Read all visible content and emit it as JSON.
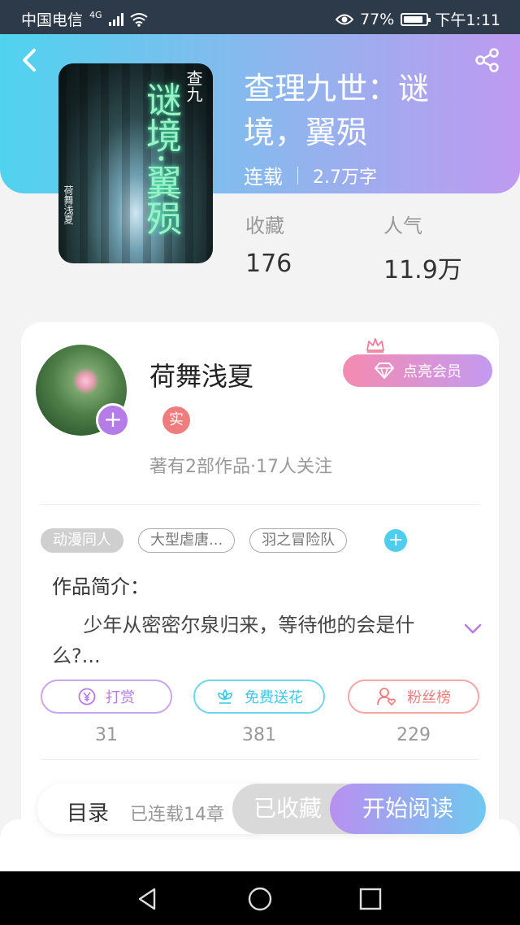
{
  "status_bar": {
    "carrier": "中国电信",
    "network": "4G",
    "battery": "77%",
    "time": "下午1:11",
    "icons": [
      "signal-icon",
      "wifi-icon",
      "eye-icon",
      "battery-icon"
    ]
  },
  "book": {
    "title": "查理九世：谜境，翼殒",
    "status": "连载",
    "word_count": "2.7万字",
    "cover_title": "谜境·翼殒",
    "cover_series": "查九",
    "cover_author": "荷舞浅夏"
  },
  "stats": {
    "favorites_label": "收藏",
    "favorites_value": "176",
    "popularity_label": "人气",
    "popularity_value": "11.9万"
  },
  "author": {
    "name": "荷舞浅夏",
    "badge": "实",
    "info": "著有2部作品·17人关注",
    "vip_button": "点亮会员"
  },
  "tags": [
    "动漫同人",
    "大型虐唐...",
    "羽之冒险队"
  ],
  "intro": {
    "title": "作品简介：",
    "text": "少年从密密尔泉归来，等待他的会是什么?..."
  },
  "actions": [
    {
      "label": "打赏",
      "count": "31",
      "icon": "yen-icon",
      "color": "#b57ce8"
    },
    {
      "label": "免费送花",
      "count": "381",
      "icon": "flower-icon",
      "color": "#3ec8e8"
    },
    {
      "label": "粉丝榜",
      "count": "229",
      "icon": "fans-icon",
      "color": "#f07d7d"
    }
  ],
  "bottom": {
    "toc_label": "目录",
    "toc_count": "已连载14章",
    "saved_label": "已收藏",
    "read_label": "开始阅读"
  },
  "colors": {
    "header_start": "#4fd3ef",
    "header_end": "#bf9af0",
    "accent_purple": "#b57ce8",
    "accent_cyan": "#3ec8e8",
    "accent_red": "#f07d7d"
  }
}
